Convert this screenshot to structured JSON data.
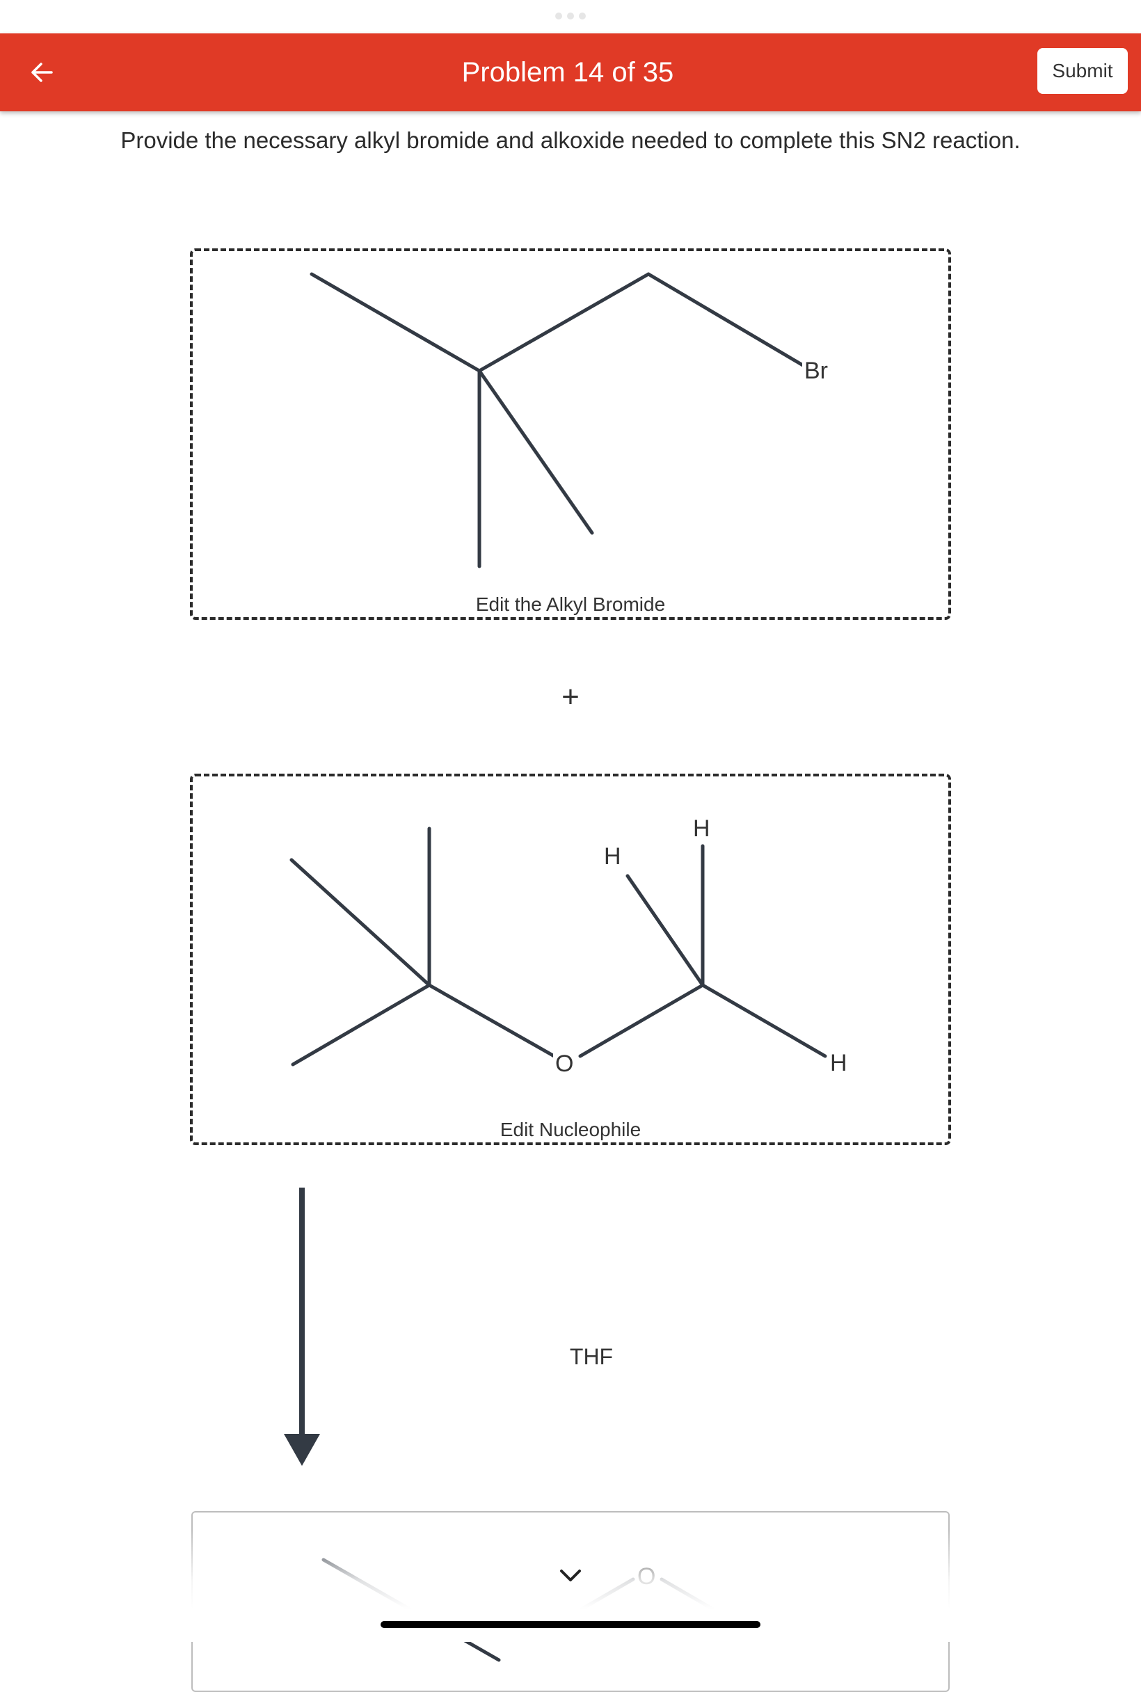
{
  "header": {
    "back_icon": "arrow-left-icon",
    "title": "Problem 14 of 35",
    "submit_label": "Submit",
    "bar_color": "#e03a26"
  },
  "instruction": "Provide the necessary alkyl bromide and alkoxide needed to complete this SN2 reaction.",
  "alkyl_bromide": {
    "atom_label": "Br",
    "edit_label": "Edit the Alkyl Bromide"
  },
  "plus": "+",
  "nucleophile": {
    "atom_labels": {
      "h_upper_right": "H",
      "h_upper_left": "H",
      "oxygen": "O",
      "h_lower_right": "H"
    },
    "edit_label": "Edit Nucleophile"
  },
  "reaction": {
    "solvent": "THF"
  },
  "product": {
    "atom_label": "O"
  }
}
